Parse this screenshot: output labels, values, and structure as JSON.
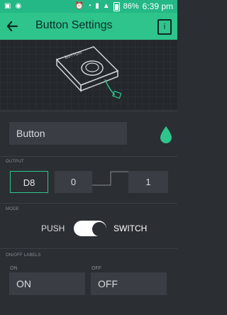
{
  "status_bar": {
    "battery": "86%",
    "time": "6:39 pm"
  },
  "app_bar": {
    "title": "Button Settings",
    "info_icon": "i"
  },
  "hero": {
    "device_label": "BUTTON"
  },
  "widget": {
    "name_value": "Button",
    "color": "#2ec48b"
  },
  "output": {
    "section_label": "OUTPUT",
    "pin": "D8",
    "low_value": "0",
    "high_value": "1"
  },
  "mode": {
    "section_label": "MODE",
    "push_label": "PUSH",
    "switch_label": "SWITCH",
    "selected": "SWITCH"
  },
  "labels": {
    "section_label": "ON/OFF LABELS",
    "on_caption": "ON",
    "on_value": "ON",
    "off_caption": "OFF",
    "off_value": "OFF"
  }
}
